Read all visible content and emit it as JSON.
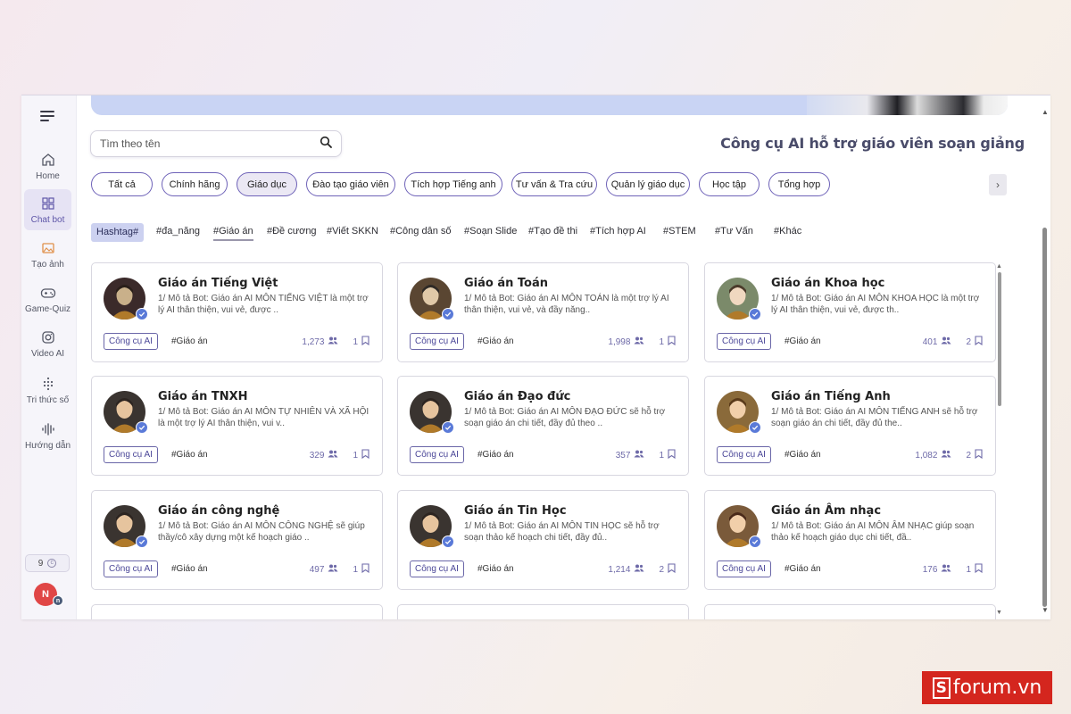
{
  "sidebar": {
    "items": [
      {
        "label": "Home",
        "icon": "home-icon"
      },
      {
        "label": "Chat bot",
        "icon": "grid-icon"
      },
      {
        "label": "Tạo ảnh",
        "icon": "image-icon"
      },
      {
        "label": "Game-Quiz",
        "icon": "gamepad-icon"
      },
      {
        "label": "Video AI",
        "icon": "instagram-icon"
      },
      {
        "label": "Tri thức số",
        "icon": "dots-icon"
      },
      {
        "label": "Hướng dẫn",
        "icon": "waveform-icon"
      }
    ],
    "credits": "9",
    "user_initial": "N",
    "user_sub": "n"
  },
  "search": {
    "placeholder": "Tìm theo tên"
  },
  "page_title": "Công cụ AI hỗ trợ giáo viên soạn giảng",
  "categories": [
    "Tất cả",
    "Chính hãng",
    "Giáo dục",
    "Đào tạo giáo viên",
    "Tích hợp Tiếng anh",
    "Tư vấn & Tra cứu",
    "Quản lý giáo dục",
    "Học tập",
    "Tổng hợp"
  ],
  "active_category": "Giáo dục",
  "hashtags": [
    "Hashtag#",
    "#đa_năng",
    "#Giáo án",
    "#Đề cương",
    "#Viết SKKN",
    "#Công dân số",
    "#Soạn Slide",
    "#Tạo đề thi",
    "#Tích hợp AI",
    "#STEM",
    "#Tư Vấn",
    "#Khác"
  ],
  "active_hashtag": "#Giáo án",
  "cards": [
    {
      "name": "Giáo án Tiếng Việt",
      "desc": "1/ Mô tả Bot: Giáo án AI MÔN TIẾNG VIỆT là một trợ lý AI thân thiện, vui vẻ, được ..",
      "category": "Công cụ AI",
      "tag": "#Giáo án",
      "users": "1,273",
      "saves": "1"
    },
    {
      "name": "Giáo án Toán",
      "desc": "1/ Mô tả Bot: Giáo án AI MÔN TOÁN là một trợ lý AI thân thiện, vui vẻ, và đầy năng..",
      "category": "Công cụ AI",
      "tag": "#Giáo án",
      "users": "1,998",
      "saves": "1"
    },
    {
      "name": "Giáo án Khoa học",
      "desc": "1/ Mô tả Bot: Giáo án AI MÔN KHOA HỌC là một trợ lý AI thân thiện, vui vẻ, được th..",
      "category": "Công cụ AI",
      "tag": "#Giáo án",
      "users": "401",
      "saves": "2"
    },
    {
      "name": "Giáo án TNXH",
      "desc": "1/ Mô tả Bot: Giáo án AI MÔN TỰ NHIÊN VÀ XÃ HỘI là một trợ lý AI thân thiện, vui v..",
      "category": "Công cụ AI",
      "tag": "#Giáo án",
      "users": "329",
      "saves": "1"
    },
    {
      "name": "Giáo án Đạo đức",
      "desc": "1/ Mô tả Bot: Giáo án AI MÔN ĐẠO ĐỨC sẽ hỗ trợ soạn giáo án chi tiết, đầy đủ theo ..",
      "category": "Công cụ AI",
      "tag": "#Giáo án",
      "users": "357",
      "saves": "1"
    },
    {
      "name": "Giáo án Tiếng Anh",
      "desc": "1/ Mô tả Bot: Giáo án AI MÔN TIẾNG ANH sẽ hỗ trợ soạn giáo án chi tiết, đầy đủ the..",
      "category": "Công cụ AI",
      "tag": "#Giáo án",
      "users": "1,082",
      "saves": "2"
    },
    {
      "name": "Giáo án công nghệ",
      "desc": "1/ Mô tả Bot: Giáo án AI MÔN CÔNG NGHỆ sẽ giúp thầy/cô xây dựng một kế hoạch giáo ..",
      "category": "Công cụ AI",
      "tag": "#Giáo án",
      "users": "497",
      "saves": "1"
    },
    {
      "name": "Giáo án Tin Học",
      "desc": "1/ Mô tả Bot: Giáo án AI MÔN TIN HỌC sẽ hỗ trợ soạn thảo kế hoạch chi tiết, đầy đủ..",
      "category": "Công cụ AI",
      "tag": "#Giáo án",
      "users": "1,214",
      "saves": "2"
    },
    {
      "name": "Giáo án Âm nhạc",
      "desc": "1/ Mô tả Bot: Giáo án AI MÔN ÂM NHẠC giúp soạn thảo kế hoạch giáo dục chi tiết, đầ..",
      "category": "Công cụ AI",
      "tag": "#Giáo án",
      "users": "176",
      "saves": "1"
    }
  ],
  "brand": {
    "name": "forum.vn",
    "mark": "S",
    "color": "#d4261e"
  },
  "colors": {
    "accent": "#6e62b8",
    "verify": "#5a7ad8",
    "hashtag_bg": "#ccd1f0"
  }
}
